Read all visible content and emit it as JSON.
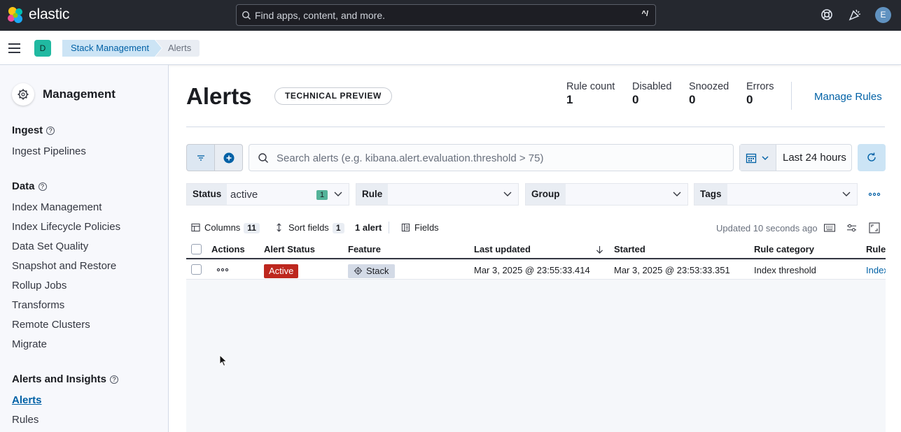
{
  "header": {
    "brand": "elastic",
    "search_placeholder": "Find apps, content, and more.",
    "search_shortcut": "^/",
    "user_initial": "E"
  },
  "subheader": {
    "space_initial": "D",
    "breadcrumbs": [
      "Stack Management",
      "Alerts"
    ]
  },
  "sidebar": {
    "title": "Management",
    "sections": [
      {
        "label": "Ingest",
        "items": [
          "Ingest Pipelines"
        ]
      },
      {
        "label": "Data",
        "items": [
          "Index Management",
          "Index Lifecycle Policies",
          "Data Set Quality",
          "Snapshot and Restore",
          "Rollup Jobs",
          "Transforms",
          "Remote Clusters",
          "Migrate"
        ]
      },
      {
        "label": "Alerts and Insights",
        "items": [
          "Alerts",
          "Rules"
        ]
      }
    ],
    "active_item": "Alerts"
  },
  "page": {
    "title": "Alerts",
    "badge": "TECHNICAL PREVIEW",
    "stats": [
      {
        "label": "Rule count",
        "value": "1"
      },
      {
        "label": "Disabled",
        "value": "0"
      },
      {
        "label": "Snoozed",
        "value": "0"
      },
      {
        "label": "Errors",
        "value": "0"
      }
    ],
    "manage_rules": "Manage Rules"
  },
  "query": {
    "placeholder": "Search alerts (e.g. kibana.alert.evaluation.threshold > 75)",
    "date_range": "Last 24 hours"
  },
  "controls": [
    {
      "label": "Status",
      "value": "active",
      "count": "1"
    },
    {
      "label": "Rule",
      "value": "",
      "count": ""
    },
    {
      "label": "Group",
      "value": "",
      "count": ""
    },
    {
      "label": "Tags",
      "value": "",
      "count": ""
    }
  ],
  "toolbar": {
    "columns_label": "Columns",
    "columns_count": "11",
    "sort_label": "Sort fields",
    "sort_count": "1",
    "alert_count": "1 alert",
    "fields_label": "Fields",
    "updated": "Updated 10 seconds ago"
  },
  "table": {
    "headers": [
      "Actions",
      "Alert Status",
      "Feature",
      "Last updated",
      "Started",
      "Rule category",
      "Rule"
    ],
    "rows": [
      {
        "status": "Active",
        "feature": "Stack",
        "last_updated": "Mar 3, 2025 @ 23:55:33.414",
        "started": "Mar 3, 2025 @ 23:53:33.351",
        "rule_category": "Index threshold",
        "rule": "Index"
      }
    ]
  },
  "colors": {
    "topbar": "#25282f",
    "primary": "#0061a6",
    "active_status": "#bd271e",
    "space": "#20b9a1"
  }
}
